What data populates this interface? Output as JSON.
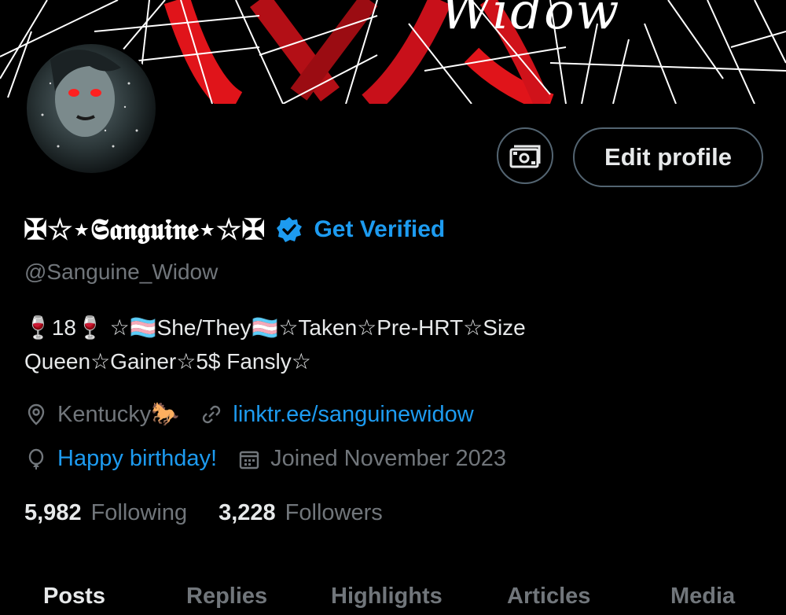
{
  "banner": {
    "text": "Widow"
  },
  "profile": {
    "display_name": "✠☆⋆𝕾𝖆𝖓𝖌𝖚𝖎𝖓𝖊⋆☆✠",
    "get_verified": "Get Verified",
    "handle": "@Sanguine_Widow",
    "bio_line1": "🍷18🍷 ☆🏳️‍⚧️She/They🏳️‍⚧️☆Taken☆Pre-HRT☆Size",
    "bio_line2": "Queen☆Gainer☆5$ Fansly☆",
    "location": "Kentucky🐎",
    "website": "linktr.ee/sanguinewidow",
    "birthday": "Happy birthday!",
    "joined": "Joined November 2023",
    "following_count": "5,982",
    "following_label": "Following",
    "followers_count": "3,228",
    "followers_label": "Followers"
  },
  "buttons": {
    "edit_profile": "Edit profile",
    "money_icon": "money-icon"
  },
  "tabs": [
    {
      "label": "Posts"
    },
    {
      "label": "Replies"
    },
    {
      "label": "Highlights"
    },
    {
      "label": "Articles"
    },
    {
      "label": "Media"
    }
  ],
  "colors": {
    "accent": "#1d9bf0",
    "muted": "#71767b",
    "text": "#e7e9ea",
    "background": "#000000",
    "banner_red": "#e0141a"
  }
}
